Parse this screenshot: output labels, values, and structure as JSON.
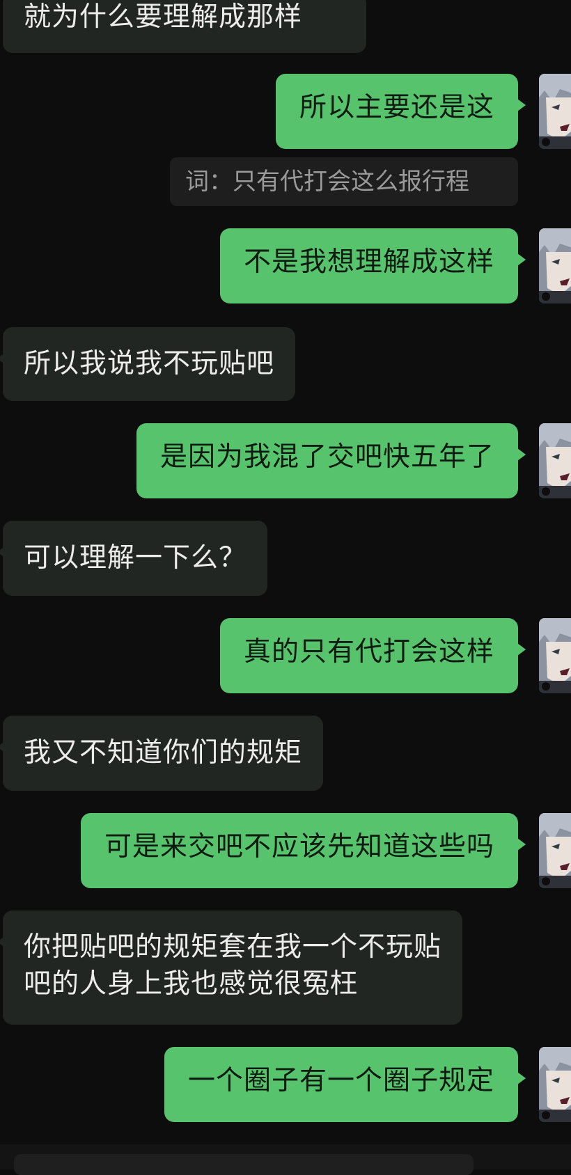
{
  "conversation": {
    "messages": [
      {
        "direction": "in",
        "text": "就为什么要理解成那样"
      },
      {
        "direction": "out",
        "text": "所以主要还是这"
      },
      {
        "direction": "out",
        "text": "不是我想理解成这样"
      },
      {
        "direction": "in",
        "text": "所以我说我不玩贴吧"
      },
      {
        "direction": "out",
        "text": "是因为我混了交吧快五年了"
      },
      {
        "direction": "in",
        "text": "可以理解一下么？"
      },
      {
        "direction": "out",
        "text": "真的只有代打会这样"
      },
      {
        "direction": "in",
        "text": "我又不知道你们的规矩"
      },
      {
        "direction": "out",
        "text": "可是来交吧不应该先知道这些吗"
      },
      {
        "direction": "in",
        "lines": [
          "你把贴吧的规矩套在我一个不玩贴",
          "吧的人身上我也感觉很冤枉"
        ]
      },
      {
        "direction": "out",
        "text": "一个圈子有一个圈子规定"
      }
    ],
    "quoted_reply": "词：只有代打会这么报行程"
  },
  "colors": {
    "background": "#0d0d0d",
    "incoming_bubble": "#222623",
    "outgoing_bubble": "#57c46d",
    "incoming_text": "#ececec",
    "outgoing_text": "#0e1b11",
    "quote_text": "#9a9a9a"
  },
  "icons": {
    "avatar": "anime-character-avatar"
  }
}
